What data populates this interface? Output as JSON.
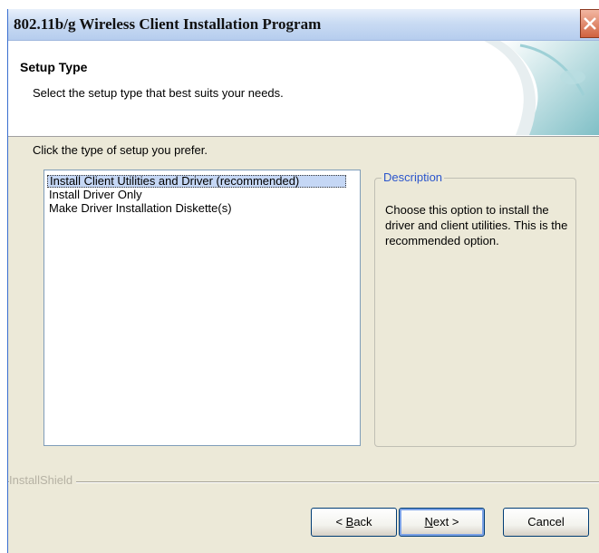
{
  "window": {
    "title": "802.11b/g Wireless Client Installation Program",
    "close_icon": "close-icon"
  },
  "header": {
    "title": "Setup Type",
    "subtitle": "Select the setup type that best suits your needs.",
    "art_icon": "installer-banner-art"
  },
  "main": {
    "prompt": "Click the type of setup you prefer.",
    "options": [
      {
        "label": "Install Client Utilities and Driver (recommended)",
        "selected": true
      },
      {
        "label": "Install Driver Only",
        "selected": false
      },
      {
        "label": "Make Driver Installation Diskette(s)",
        "selected": false
      }
    ],
    "description": {
      "legend": "Description",
      "text": "Choose this option to install the driver and client utilities. This is the recommended option."
    }
  },
  "footer": {
    "brand": "InstallShield",
    "back": {
      "prefix": "< ",
      "mnemonic": "B",
      "rest": "ack"
    },
    "next": {
      "mnemonic": "N",
      "rest": "ext >"
    },
    "cancel": "Cancel"
  },
  "colors": {
    "selection": "#c5d7f5",
    "legend": "#2b55cc",
    "dialog_bg": "#ece9d8"
  }
}
